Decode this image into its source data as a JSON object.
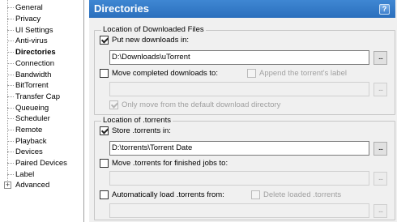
{
  "sidebar": {
    "items": [
      {
        "label": "General"
      },
      {
        "label": "Privacy"
      },
      {
        "label": "UI Settings"
      },
      {
        "label": "Anti-virus"
      },
      {
        "label": "Directories"
      },
      {
        "label": "Connection"
      },
      {
        "label": "Bandwidth"
      },
      {
        "label": "BitTorrent"
      },
      {
        "label": "Transfer Cap"
      },
      {
        "label": "Queueing"
      },
      {
        "label": "Scheduler"
      },
      {
        "label": "Remote"
      },
      {
        "label": "Playback"
      },
      {
        "label": "Devices"
      },
      {
        "label": "Paired Devices"
      },
      {
        "label": "Label"
      },
      {
        "label": "Advanced"
      }
    ],
    "selected": "Directories",
    "expander_symbol": "+"
  },
  "header": {
    "title": "Directories",
    "help_label": "?"
  },
  "downloaded": {
    "group_title": "Location of Downloaded Files",
    "put_new_label": "Put new downloads in:",
    "put_new_checked": true,
    "put_new_path": "D:\\Downloads\\uTorrent",
    "move_completed_label": "Move completed downloads to:",
    "move_completed_checked": false,
    "append_label": "Append the torrent's label",
    "append_checked": false,
    "move_completed_path": "",
    "only_move_label": "Only move from the default download directory",
    "only_move_checked": true,
    "browse_label": "..."
  },
  "torrents": {
    "group_title": "Location of .torrents",
    "store_label": "Store .torrents in:",
    "store_checked": true,
    "store_path": "D:\\torrents\\Torrent Date",
    "move_finished_label": "Move .torrents for finished jobs to:",
    "move_finished_checked": false,
    "move_finished_path": "",
    "auto_load_label": "Automatically load .torrents from:",
    "auto_load_checked": false,
    "delete_loaded_label": "Delete loaded .torrents",
    "delete_loaded_checked": false,
    "auto_load_path": "",
    "browse_label": "..."
  },
  "colors": {
    "header_blue": "#2f77c6",
    "header_text": "#ffffff",
    "panel_bg": "#f0f0f0"
  }
}
